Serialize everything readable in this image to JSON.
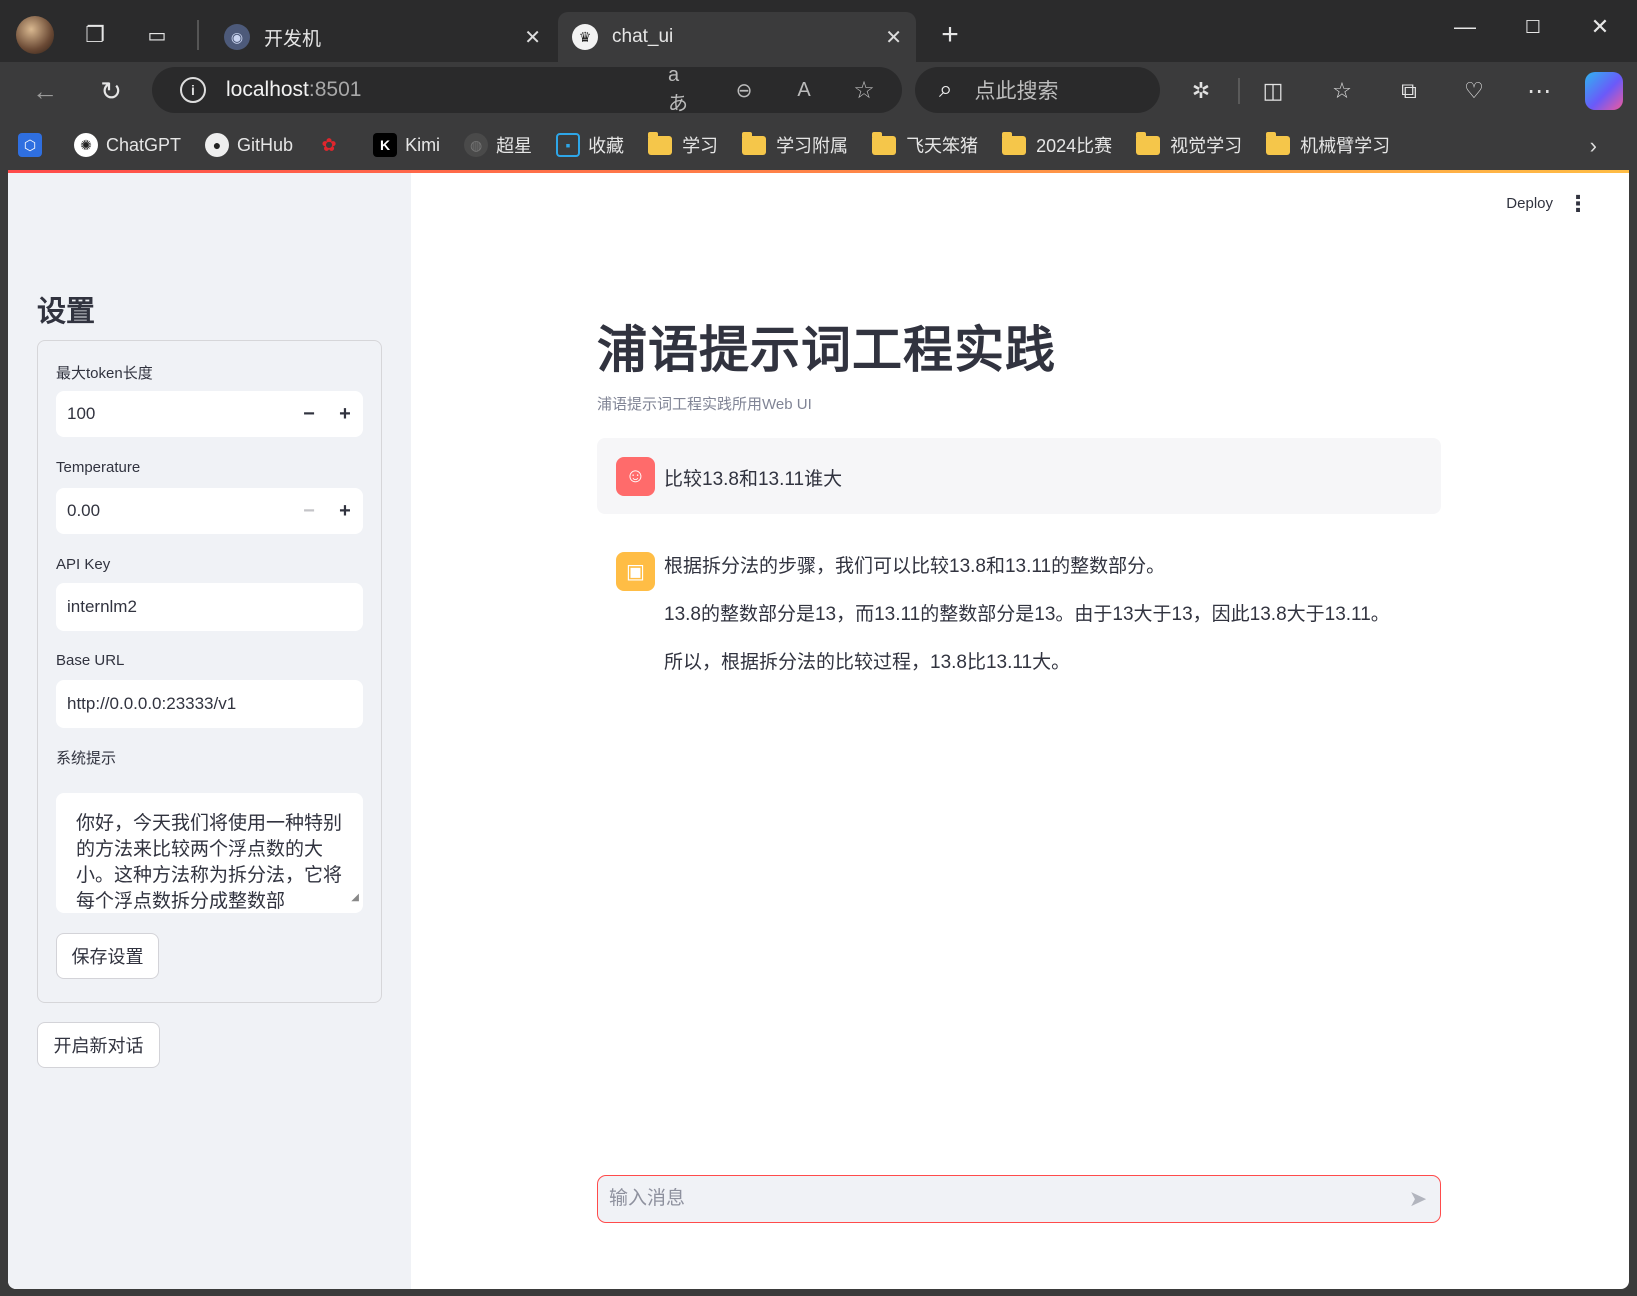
{
  "browser": {
    "tabs": [
      {
        "title": "开发机",
        "icon": "robot-favicon"
      },
      {
        "title": "chat_ui",
        "icon": "streamlit-crown-favicon"
      }
    ],
    "address": {
      "host": "localhost",
      "port": ":8501"
    },
    "search_placeholder": "点此搜索",
    "bookmarks": [
      {
        "label": "",
        "icon": "app-logo"
      },
      {
        "label": "ChatGPT",
        "icon": "openai-icon"
      },
      {
        "label": "GitHub",
        "icon": "github-icon"
      },
      {
        "label": "",
        "icon": "huawei-icon"
      },
      {
        "label": "Kimi",
        "icon": "kimi-icon"
      },
      {
        "label": "超星",
        "icon": "globe-icon"
      },
      {
        "label": "收藏",
        "icon": "bilibili-icon"
      },
      {
        "label": "学习",
        "icon": "folder-icon"
      },
      {
        "label": "学习附属",
        "icon": "folder-icon"
      },
      {
        "label": "飞天笨猪",
        "icon": "folder-icon"
      },
      {
        "label": "2024比赛",
        "icon": "folder-icon"
      },
      {
        "label": "视觉学习",
        "icon": "folder-icon"
      },
      {
        "label": "机械臂学习",
        "icon": "folder-icon"
      }
    ]
  },
  "header": {
    "deploy_label": "Deploy"
  },
  "sidebar": {
    "title": "设置",
    "max_tokens": {
      "label": "最大token长度",
      "value": "100"
    },
    "temperature": {
      "label": "Temperature",
      "value": "0.00"
    },
    "api_key": {
      "label": "API Key",
      "value": "internlm2"
    },
    "base_url": {
      "label": "Base URL",
      "value": "http://0.0.0.0:23333/v1"
    },
    "system_prompt": {
      "label": "系统提示",
      "value": "你好，今天我们将使用一种特别的方法来比较两个浮点数的大小。这种方法称为拆分法，它将每个浮点数拆分成整数部"
    },
    "save_label": "保存设置",
    "new_chat_label": "开启新对话"
  },
  "main": {
    "title": "浦语提示词工程实践",
    "caption": "浦语提示词工程实践所用Web UI",
    "messages": [
      {
        "role": "user",
        "text": "比较13.8和13.11谁大"
      },
      {
        "role": "assistant",
        "lines": [
          "根据拆分法的步骤，我们可以比较13.8和13.11的整数部分。",
          "13.8的整数部分是13，而13.11的整数部分是13。由于13大于13，因此13.8大于13.11。",
          "所以，根据拆分法的比较过程，13.8比13.11大。"
        ]
      }
    ],
    "input_placeholder": "输入消息"
  },
  "colors": {
    "accent": "#ff4b4b",
    "sidebar_bg": "#f0f2f6",
    "user_avatar": "#ff6b6b",
    "bot_avatar": "#ffbd45"
  }
}
